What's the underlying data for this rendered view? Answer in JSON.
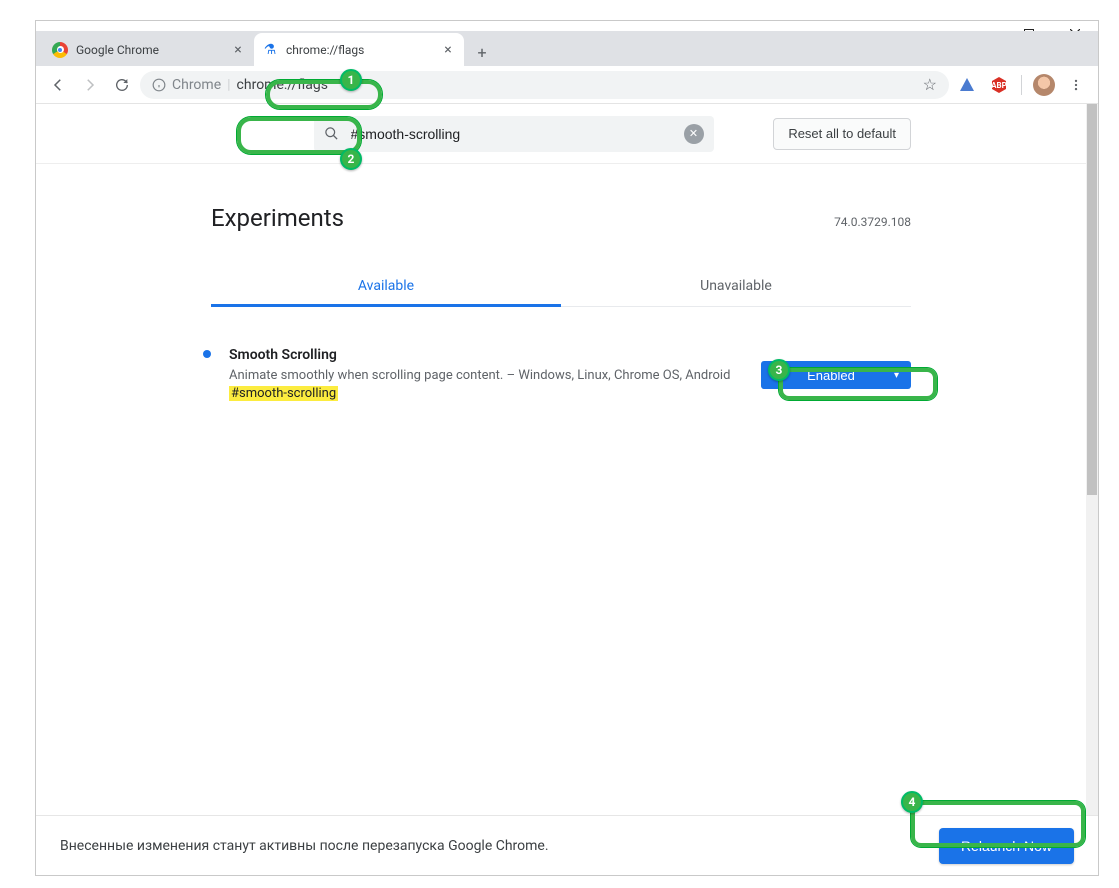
{
  "window": {
    "tabs": [
      {
        "title": "Google Chrome",
        "active": false
      },
      {
        "title": "chrome://flags",
        "active": true
      }
    ]
  },
  "omnibox": {
    "label": "Chrome",
    "url": "chrome://flags"
  },
  "search": {
    "value": "#smooth-scrolling"
  },
  "buttons": {
    "reset": "Reset all to default",
    "relaunch": "Relaunch Now"
  },
  "headings": {
    "experiments": "Experiments",
    "version": "74.0.3729.108"
  },
  "tabs": {
    "available": "Available",
    "unavailable": "Unavailable"
  },
  "flag": {
    "name": "Smooth Scrolling",
    "desc": "Animate smoothly when scrolling page content. – Windows, Linux, Chrome OS, Android",
    "hash": "#smooth-scrolling",
    "select": "Enabled"
  },
  "relaunch": {
    "message": "Внесенные изменения станут активны после перезапуска Google Chrome."
  },
  "annotations": {
    "n1": "1",
    "n2": "2",
    "n3": "3",
    "n4": "4"
  }
}
